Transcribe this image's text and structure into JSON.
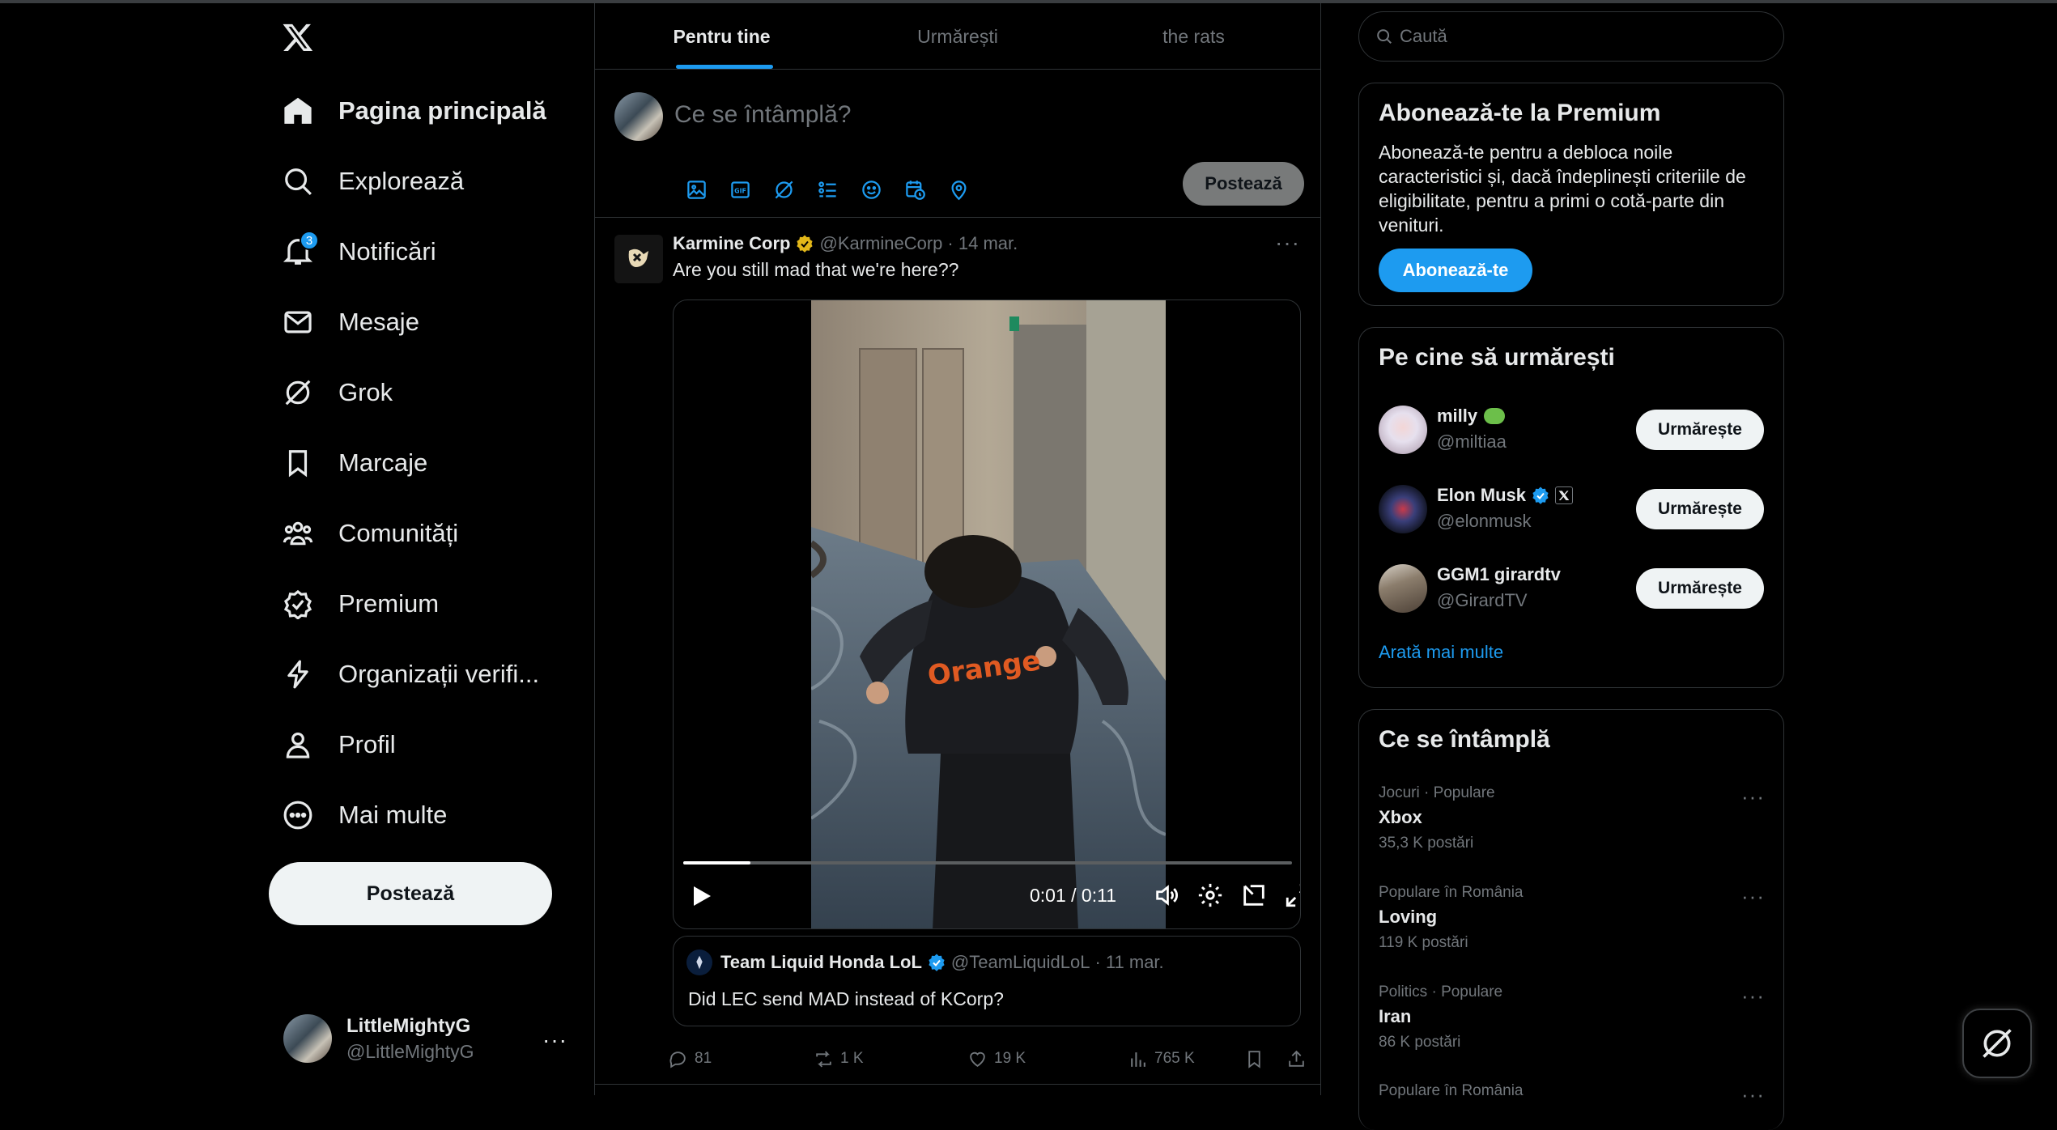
{
  "nav": {
    "items": [
      {
        "label": "Pagina principală",
        "icon": "home-icon",
        "active": true
      },
      {
        "label": "Explorează",
        "icon": "search-icon"
      },
      {
        "label": "Notificări",
        "icon": "bell-icon",
        "badge": "3"
      },
      {
        "label": "Mesaje",
        "icon": "mail-icon"
      },
      {
        "label": "Grok",
        "icon": "grok-icon"
      },
      {
        "label": "Marcaje",
        "icon": "bookmark-icon"
      },
      {
        "label": "Comunități",
        "icon": "communities-icon"
      },
      {
        "label": "Premium",
        "icon": "premium-icon"
      },
      {
        "label": "Organizații verifi...",
        "icon": "lightning-icon"
      },
      {
        "label": "Profil",
        "icon": "profile-icon"
      },
      {
        "label": "Mai multe",
        "icon": "more-circle-icon"
      }
    ],
    "post_button": "Postează",
    "account": {
      "name": "LittleMightyG",
      "handle": "@LittleMightyG",
      "more": "···"
    }
  },
  "feed": {
    "tabs": [
      {
        "label": "Pentru tine",
        "active": true
      },
      {
        "label": "Urmărești"
      },
      {
        "label": "the rats"
      }
    ],
    "composer": {
      "placeholder": "Ce se întâmplă?",
      "post_button": "Postează"
    },
    "tweet": {
      "name": "Karmine Corp",
      "handle": "@KarmineCorp",
      "date": "· 14 mar.",
      "text": "Are you still mad that we're here??",
      "more": "···",
      "video": {
        "time": "0:01 / 0:11",
        "progress": 0.11,
        "jersey_text": "Orange"
      },
      "quote": {
        "name": "Team Liquid Honda LoL",
        "handle": "@TeamLiquidLoL",
        "date": "· 11 mar.",
        "text": "Did LEC send MAD instead of KCorp?"
      },
      "stats": {
        "replies": "81",
        "reposts": "1 K",
        "likes": "19 K",
        "views": "765 K"
      }
    }
  },
  "sidebar": {
    "search_placeholder": "Caută",
    "premium": {
      "title": "Abonează-te la Premium",
      "text": "Abonează-te pentru a debloca noile caracteristici și, dacă îndeplinești criteriile de eligibilitate, pentru a primi o cotă-parte din venituri.",
      "button": "Abonează-te"
    },
    "who_to_follow": {
      "title": "Pe cine să urmărești",
      "users": [
        {
          "name": "milly",
          "handle": "@miltiaa",
          "button": "Urmărește"
        },
        {
          "name": "Elon Musk",
          "handle": "@elonmusk",
          "button": "Urmărește"
        },
        {
          "name": "GGM1 girardtv",
          "handle": "@GirardTV",
          "button": "Urmărește"
        }
      ],
      "show_more": "Arată mai multe"
    },
    "trends": {
      "title": "Ce se întâmplă",
      "items": [
        {
          "meta": "Jocuri · Populare",
          "name": "Xbox",
          "count": "35,3 K postări"
        },
        {
          "meta": "Populare în România",
          "name": "Loving",
          "count": "119 K postări"
        },
        {
          "meta": "Politics · Populare",
          "name": "Iran",
          "count": "86 K postări"
        },
        {
          "meta": "Populare în România"
        }
      ],
      "more": "···"
    }
  },
  "colors": {
    "accent": "#1d9bf0",
    "gold_verified": "#e2b719",
    "background": "#000000",
    "muted": "#71767b"
  }
}
